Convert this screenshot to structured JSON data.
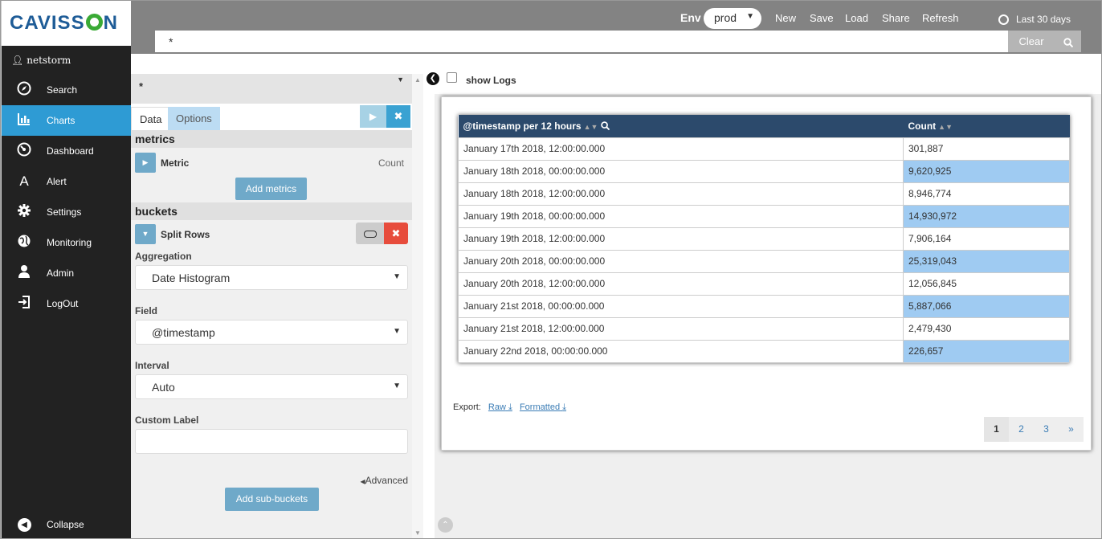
{
  "brand": {
    "logo_text_1": "CAVISS",
    "logo_text_2": "N",
    "username": "netstorm"
  },
  "sidebar": {
    "items": [
      {
        "label": "Search",
        "icon": "compass-icon"
      },
      {
        "label": "Charts",
        "icon": "bar-chart-icon"
      },
      {
        "label": "Dashboard",
        "icon": "dashboard-icon"
      },
      {
        "label": "Alert",
        "icon": "alert-icon"
      },
      {
        "label": "Settings",
        "icon": "gear-icon"
      },
      {
        "label": "Monitoring",
        "icon": "globe-icon"
      },
      {
        "label": "Admin",
        "icon": "user-icon"
      },
      {
        "label": "LogOut",
        "icon": "logout-icon"
      }
    ],
    "collapse_label": "Collapse",
    "active_index": 1
  },
  "topbar": {
    "env_label": "Env",
    "env_value": "prod",
    "links": {
      "new": "New",
      "save": "Save",
      "load": "Load",
      "share": "Share",
      "refresh": "Refresh"
    },
    "time_range": "Last 30 days",
    "query": "*",
    "clear_label": "Clear"
  },
  "editor": {
    "index_pattern": "*",
    "tabs": {
      "data": "Data",
      "options": "Options"
    },
    "metrics_title": "metrics",
    "metric_label": "Metric",
    "metric_type": "Count",
    "add_metrics_label": "Add metrics",
    "buckets_title": "buckets",
    "split_rows_label": "Split Rows",
    "aggregation_label": "Aggregation",
    "aggregation_value": "Date Histogram",
    "field_label": "Field",
    "field_value": "@timestamp",
    "interval_label": "Interval",
    "interval_value": "Auto",
    "custom_label_label": "Custom Label",
    "custom_label_value": "",
    "advanced_label": "Advanced",
    "add_sub_buckets_label": "Add sub-buckets"
  },
  "results": {
    "show_logs_label": "show Logs",
    "columns": {
      "timestamp": "@timestamp per 12 hours",
      "count": "Count"
    },
    "rows": [
      {
        "ts": "January 17th 2018, 12:00:00.000",
        "count": "301,887",
        "highlight": false
      },
      {
        "ts": "January 18th 2018, 00:00:00.000",
        "count": "9,620,925",
        "highlight": true
      },
      {
        "ts": "January 18th 2018, 12:00:00.000",
        "count": "8,946,774",
        "highlight": false
      },
      {
        "ts": "January 19th 2018, 00:00:00.000",
        "count": "14,930,972",
        "highlight": true
      },
      {
        "ts": "January 19th 2018, 12:00:00.000",
        "count": "7,906,164",
        "highlight": false
      },
      {
        "ts": "January 20th 2018, 00:00:00.000",
        "count": "25,319,043",
        "highlight": true
      },
      {
        "ts": "January 20th 2018, 12:00:00.000",
        "count": "12,056,845",
        "highlight": false
      },
      {
        "ts": "January 21st 2018, 00:00:00.000",
        "count": "5,887,066",
        "highlight": true
      },
      {
        "ts": "January 21st 2018, 12:00:00.000",
        "count": "2,479,430",
        "highlight": false
      },
      {
        "ts": "January 22nd 2018, 00:00:00.000",
        "count": "226,657",
        "highlight": true
      }
    ],
    "export_label": "Export:",
    "export_raw": "Raw",
    "export_formatted": "Formatted",
    "pages": [
      "1",
      "2",
      "3",
      "»"
    ],
    "current_page": "1"
  },
  "colors": {
    "sidebar_bg": "#222222",
    "active_nav": "#2e9bd4",
    "table_header": "#2c4a6c",
    "highlight_cell": "#9fcbf2",
    "topbar_bg": "#838383"
  }
}
